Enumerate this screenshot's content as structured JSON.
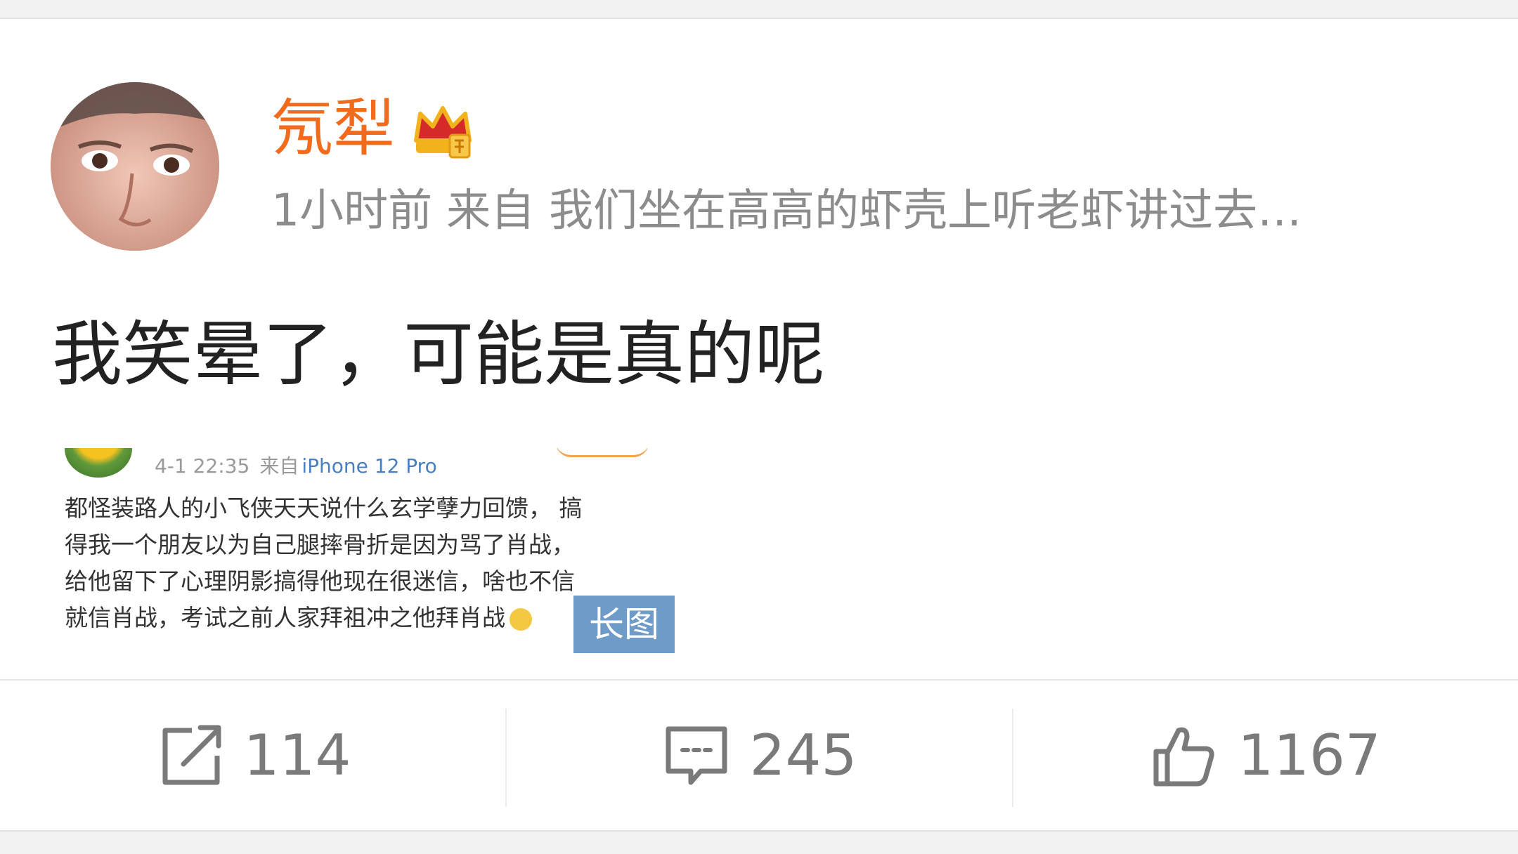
{
  "post": {
    "username": "氖犁",
    "meta": "1小时前  来自  我们坐在高高的虾壳上听老虾讲过去…",
    "text": "我笑晕了，可能是真的呢"
  },
  "embedded_screenshot": {
    "time": "4-1 22:35",
    "source_label": "来自",
    "device": "iPhone 12 Pro",
    "lines": [
      "都怪装路人的小飞侠天天说什么玄学孽力回馈， 搞",
      "得我一个朋友以为自己腿摔骨折是因为骂了肖战，",
      "给他留下了心理阴影搞得他现在很迷信，啥也不信",
      "就信肖战，考试之前人家拜祖冲之他拜肖战"
    ],
    "long_image_label": "长图"
  },
  "actions": {
    "repost_count": "114",
    "comment_count": "245",
    "like_count": "1167"
  },
  "icons": {
    "repost": "share-icon",
    "comment": "comment-icon",
    "like": "thumbs-up-icon",
    "badge": "crown-badge-icon"
  },
  "colors": {
    "username": "#f26b1d",
    "meta": "#8c8c8c",
    "long_tag": "#6f9bc9"
  }
}
